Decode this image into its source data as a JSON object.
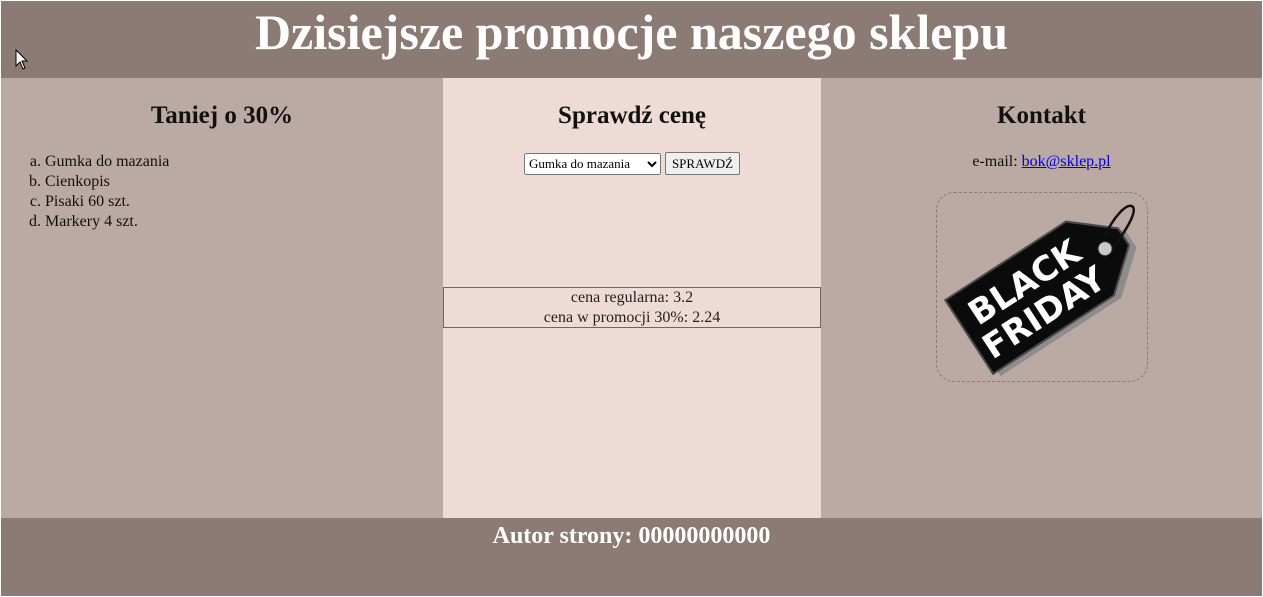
{
  "header": {
    "title": "Dzisiejsze promocje naszego sklepu"
  },
  "left": {
    "heading": "Taniej o 30%",
    "items": [
      "Gumka do mazania",
      "Cienkopis",
      "Pisaki 60 szt.",
      "Markery 4 szt."
    ]
  },
  "middle": {
    "heading": "Sprawdź cenę",
    "select_value": "Gumka do mazania",
    "button_label": "SPRAWDŹ",
    "regular_price_line": "cena regularna: 3.2",
    "promo_price_line": "cena w promocji 30%: 2.24"
  },
  "right": {
    "heading": "Kontakt",
    "email_label": "e-mail: ",
    "email_link": "bok@sklep.pl",
    "image_caption_line1": "BLACK",
    "image_caption_line2": "FRIDAY"
  },
  "footer": {
    "author": "Autor strony: 00000000000"
  },
  "colors": {
    "header_footer_bg": "#8c7b74",
    "side_column_bg": "#bba9a3",
    "middle_column_bg": "#eedbd5"
  },
  "icons": {
    "cursor": "mouse-pointer-icon",
    "tag": "black-friday-tag-image"
  }
}
